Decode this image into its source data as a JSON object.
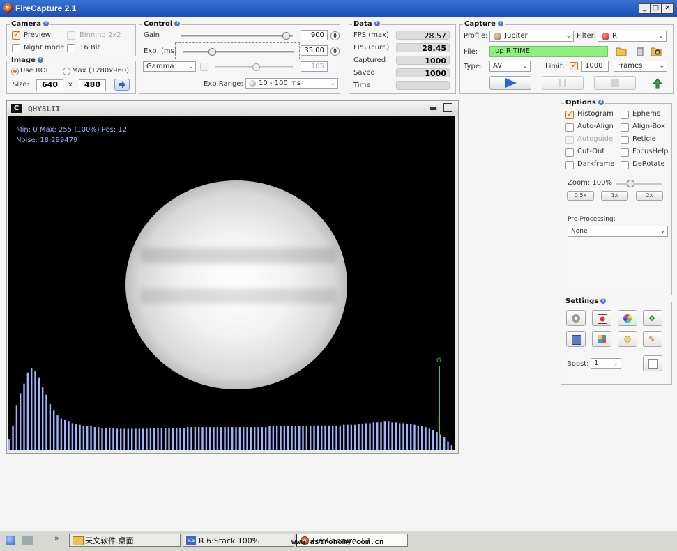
{
  "window": {
    "title": "FireCapture 2.1",
    "min_label": "_",
    "max_label": "□",
    "close_label": "✕"
  },
  "camera": {
    "title": "Camera",
    "preview": "Preview",
    "binning": "Binning 2x2",
    "night_mode": "Night mode",
    "bit16": "16 Bit"
  },
  "image": {
    "title": "Image",
    "use_roi": "Use ROI",
    "max": "Max (1280x960)",
    "size_label": "Size:",
    "width": "640",
    "x": "x",
    "height": "480"
  },
  "control": {
    "title": "Control",
    "gain_label": "Gain",
    "gain_value": "900",
    "gain_level": 0.94,
    "exp_label": "Exp. (ms)",
    "exp_value": "35.00",
    "exp_level": 0.26,
    "gamma_option": "Gamma",
    "gamma_value": "105",
    "gamma_level": 0.52,
    "exp_range_label": "Exp.Range:",
    "exp_range_value": "10 - 100 ms"
  },
  "data": {
    "title": "Data",
    "rows": [
      {
        "label": "FPS (max)",
        "value": "28.57"
      },
      {
        "label": "FPS (curr.)",
        "value": "28.45"
      },
      {
        "label": "Captured",
        "value": "1000"
      },
      {
        "label": "Saved",
        "value": "1000"
      },
      {
        "label": "Time",
        "value": ""
      }
    ]
  },
  "capture": {
    "title": "Capture",
    "profile_label": "Profile:",
    "profile_value": "Jupiter",
    "filter_label": "Filter:",
    "filter_value": "R",
    "file_label": "File:",
    "file_value": "Jup R TIME",
    "type_label": "Type:",
    "type_value": "AVI",
    "limit_label": "Limit:",
    "limit_value": "1000",
    "limit_unit": "Frames"
  },
  "viewer": {
    "camera_name": "QHY5LII",
    "stats_line": "Min: 0     Max: 255 (100%)    Pos: 12",
    "noise": "Noise: 18.299479",
    "marker_label": "G",
    "histogram": [
      14,
      30,
      56,
      72,
      84,
      98,
      104,
      100,
      92,
      80,
      70,
      58,
      50,
      44,
      40,
      38,
      36,
      34,
      33,
      32,
      31,
      30,
      30,
      29,
      29,
      28,
      28,
      28,
      28,
      27,
      27,
      27,
      27,
      27,
      27,
      27,
      27,
      27,
      28,
      28,
      28,
      28,
      28,
      28,
      28,
      28,
      28,
      28,
      29,
      29,
      29,
      29,
      29,
      29,
      29,
      29,
      29,
      29,
      29,
      29,
      29,
      29,
      29,
      29,
      29,
      29,
      29,
      29,
      29,
      29,
      30,
      30,
      30,
      30,
      30,
      30,
      30,
      30,
      30,
      30,
      30,
      31,
      31,
      31,
      31,
      31,
      31,
      31,
      31,
      31,
      32,
      32,
      32,
      32,
      33,
      33,
      34,
      34,
      35,
      35,
      35,
      36,
      36,
      35,
      35,
      34,
      34,
      33,
      33,
      32,
      31,
      30,
      29,
      27,
      25,
      23,
      20,
      16,
      11,
      6
    ]
  },
  "options": {
    "title": "Options",
    "items": [
      {
        "label": "Histogram",
        "checked": true,
        "enabled": true
      },
      {
        "label": "Ephems",
        "checked": false,
        "enabled": true
      },
      {
        "label": "Auto-Align",
        "checked": false,
        "enabled": true
      },
      {
        "label": "Align-Box",
        "checked": false,
        "enabled": true
      },
      {
        "label": "Autoguide",
        "checked": false,
        "enabled": false
      },
      {
        "label": "Reticle",
        "checked": false,
        "enabled": true
      },
      {
        "label": "Cut-Out",
        "checked": false,
        "enabled": true
      },
      {
        "label": "FocusHelp",
        "checked": false,
        "enabled": true
      },
      {
        "label": "Darkframe",
        "checked": false,
        "enabled": true
      },
      {
        "label": "DeRotate",
        "checked": false,
        "enabled": true
      }
    ],
    "zoom_label": "Zoom: 100%",
    "zoom_level": 0.3,
    "zoom_buttons": [
      "0.5x",
      "1x",
      "2x"
    ],
    "preprocessing_label": "Pre-Processing:",
    "preprocessing_value": "None"
  },
  "settings": {
    "title": "Settings",
    "boost_label": "Boost:",
    "boost_value": "1"
  },
  "taskbar": {
    "overflow": "»",
    "items": [
      "天文软件.桌面",
      "R 6:Stack 100%",
      "FireCapture 2.1"
    ],
    "watermark": "www.astronomy.com.cn"
  }
}
